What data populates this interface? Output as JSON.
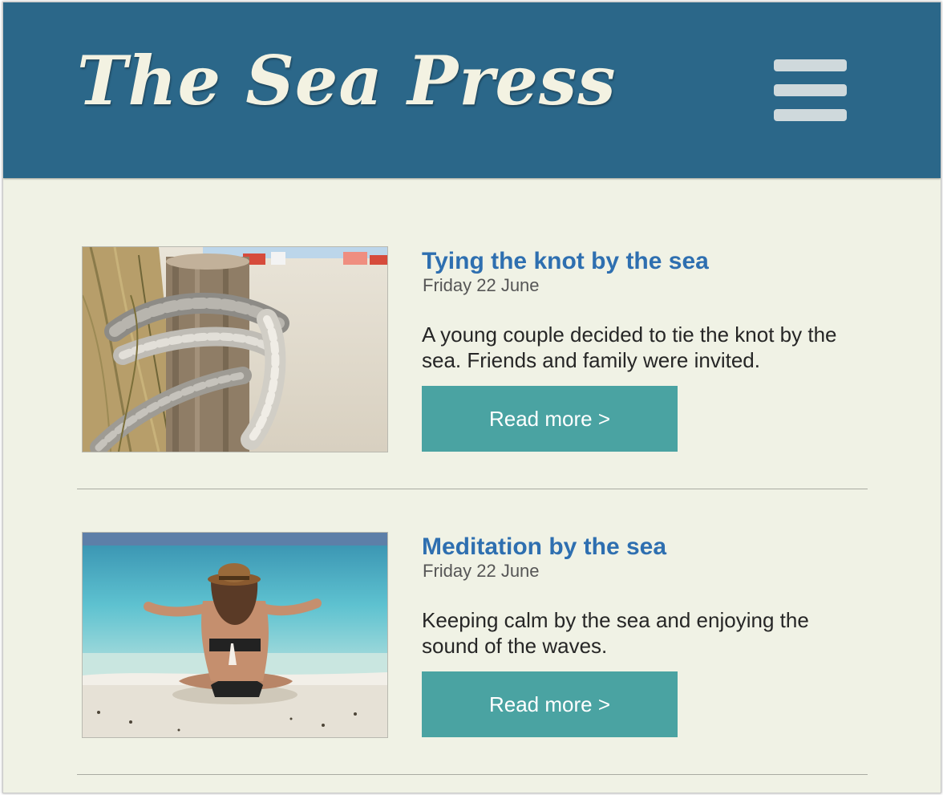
{
  "header": {
    "logo_text": "The Sea Press",
    "menu_icon": "hamburger-menu-icon",
    "background_color": "#2b6789"
  },
  "articles": [
    {
      "title": "Tying the knot by the sea",
      "date": "Friday 22 June",
      "summary": "A young couple decided to tie the knot by the sea. Friends and family were invited.",
      "button_label": "Read more >",
      "image_icon": "rope-on-post-beach-photo"
    },
    {
      "title": "Meditation by the sea",
      "date": "Friday 22 June",
      "summary": "Keeping calm by the sea and enjoying the sound of the waves.",
      "button_label": "Read more >",
      "image_icon": "woman-meditating-beach-photo"
    }
  ],
  "colors": {
    "title": "#2e6fb0",
    "button": "#4aa3a2",
    "page_background": "#f0f2e5"
  }
}
